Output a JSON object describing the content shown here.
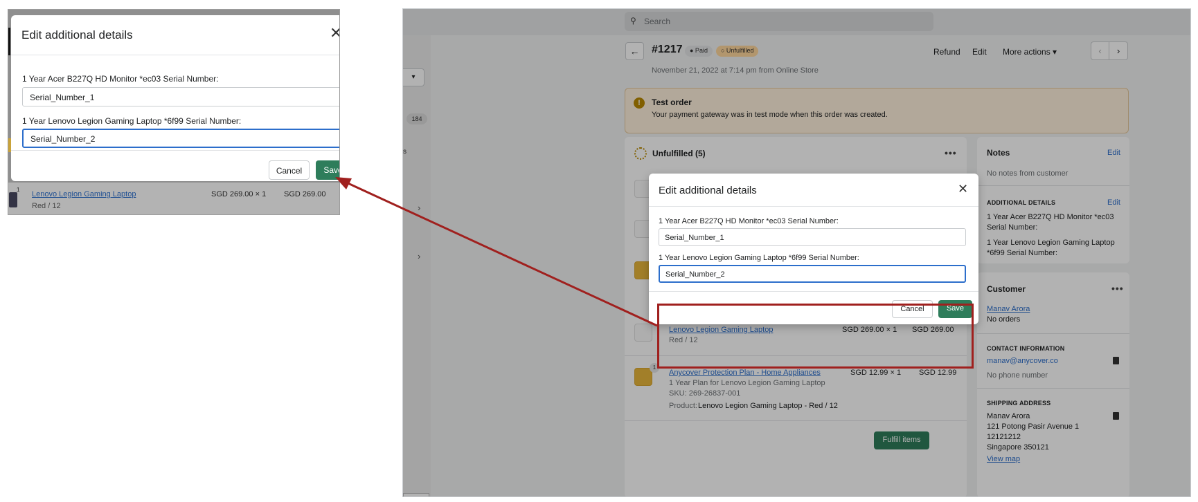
{
  "colors": {
    "accent_green": "#2e7d5b",
    "link_blue": "#2c6ecb",
    "callout_red": "#a0201e",
    "warning_bg": "#fff1dd",
    "unfulfilled_badge": "#ffd79d"
  },
  "topbar": {
    "search_placeholder": "Search",
    "search_icon": "search-icon"
  },
  "sidebar": {
    "count": "184",
    "clipped_text": "s"
  },
  "order": {
    "id": "#1217",
    "badge_paid": "● Paid",
    "badge_unfulfilled": "○ Unfulfilled",
    "date": "November 21, 2022 at 7:14 pm from Online Store",
    "actions": {
      "refund": "Refund",
      "edit": "Edit",
      "more": "More actions ▾"
    },
    "nav_prev": "‹",
    "nav_next": "›",
    "back": "←"
  },
  "banner": {
    "icon": "!",
    "title": "Test order",
    "text": "Your payment gateway was in test mode when this order was created."
  },
  "unfulfilled": {
    "title": "Unfulfilled (5)",
    "more": "•••",
    "items": [
      {
        "name": "Lenovo Legion Gaming Laptop",
        "variant": "Red / 12",
        "unit": "SGD 269.00 × 1",
        "total": "SGD 269.00"
      },
      {
        "qty": "1",
        "name": "Anycover Protection Plan - Home Appliances",
        "desc": "1 Year Plan for Lenovo Legion Gaming Laptop",
        "sku": "SKU: 269-26837-001",
        "product_label": "Product:",
        "product_value": "Lenovo Legion Gaming Laptop - Red / 12",
        "unit": "SGD 12.99 × 1",
        "total": "SGD 12.99"
      }
    ],
    "fulfill_button": "Fulfill items"
  },
  "notes": {
    "title": "Notes",
    "edit": "Edit",
    "empty": "No notes from customer",
    "additional_title": "ADDITIONAL DETAILS",
    "additional_edit": "Edit",
    "detail1": "1 Year Acer B227Q HD Monitor *ec03 Serial Number:",
    "detail2": "1 Year Lenovo Legion Gaming Laptop *6f99 Serial Number:"
  },
  "customer": {
    "title": "Customer",
    "more": "•••",
    "name": "Manav Arora",
    "orders": "No orders",
    "contact_title": "CONTACT INFORMATION",
    "email": "manav@anycover.co",
    "phone": "No phone number",
    "shipping_title": "SHIPPING ADDRESS",
    "address": [
      "Manav Arora",
      "121 Potong Pasir Avenue 1",
      "12121212",
      "Singapore 350121"
    ],
    "view_map": "View map"
  },
  "modal": {
    "title": "Edit additional details",
    "close": "✕",
    "field1_label": "1 Year Acer B227Q HD Monitor *ec03 Serial Number:",
    "field1_value": "Serial_Number_1",
    "field2_label": "1 Year Lenovo Legion Gaming Laptop *6f99 Serial Number:",
    "field2_value": "Serial_Number_2",
    "cancel": "Cancel",
    "save": "Save"
  },
  "inset_background": {
    "qty": "1",
    "item_name": "Lenovo Legion Gaming Laptop",
    "variant": "Red / 12",
    "unit": "SGD 269.00 × 1",
    "total": "SGD 269.00"
  }
}
